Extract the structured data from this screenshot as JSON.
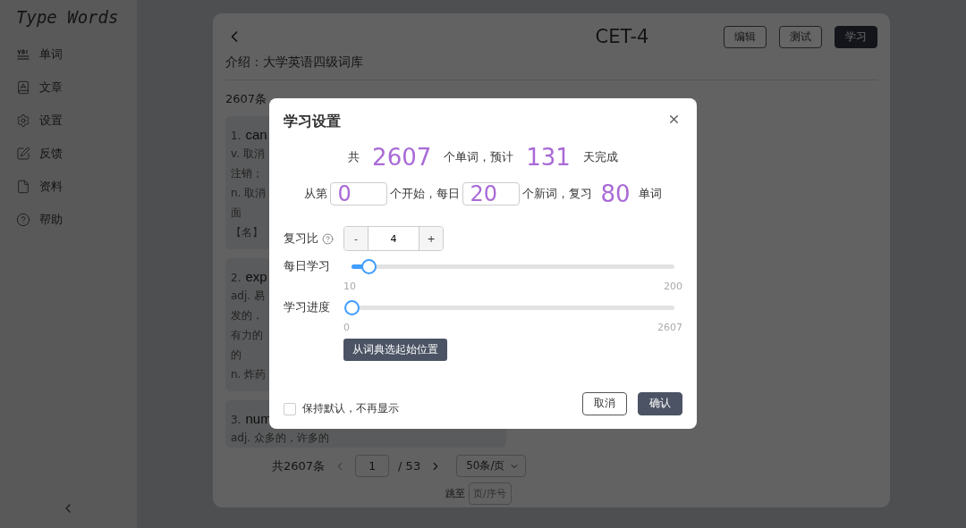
{
  "sidebar": {
    "logo": "Type Words",
    "items": [
      {
        "label": "单词"
      },
      {
        "label": "文章"
      },
      {
        "label": "设置"
      },
      {
        "label": "反馈"
      },
      {
        "label": "资料"
      },
      {
        "label": "帮助"
      }
    ]
  },
  "panel": {
    "title": "CET-4",
    "intro": "介绍：大学英语四级词库",
    "count": "2607条",
    "buttons": [
      {
        "label": "编辑",
        "kind": "outline"
      },
      {
        "label": "测试",
        "kind": "outline"
      },
      {
        "label": "学习",
        "kind": "primary"
      }
    ],
    "words": [
      {
        "index": "1.",
        "word": "can",
        "lines": [
          "v. 取消",
          "注销；",
          "n. 取消",
          "面",
          "【名】"
        ]
      },
      {
        "index": "2.",
        "word": "exp",
        "lines": [
          "adj. 易",
          "发的，",
          "有力的",
          "的",
          "n. 炸药"
        ]
      },
      {
        "index": "3.",
        "word": "num",
        "lines": [
          "adj. 众多的，许多的"
        ]
      }
    ],
    "pagination": {
      "total": "共2607条",
      "page": "1",
      "pages": "/ 53",
      "page_size": "50条/页",
      "jump_label": "跳至",
      "jump_placeholder": "页/序号"
    }
  },
  "dialog": {
    "title": "学习设置",
    "summary": [
      {
        "kind": "text",
        "text": "共"
      },
      {
        "kind": "number",
        "text": "2607"
      },
      {
        "kind": "text",
        "text": "个单词，预计"
      },
      {
        "kind": "number",
        "text": "131"
      },
      {
        "kind": "text",
        "text": "天完成"
      }
    ],
    "plan": [
      {
        "kind": "text",
        "text": "从第"
      },
      {
        "kind": "input",
        "text": "0"
      },
      {
        "kind": "text",
        "text": "个开始，每日"
      },
      {
        "kind": "input",
        "text": "20"
      },
      {
        "kind": "text",
        "text": "个新词，复习"
      },
      {
        "kind": "number",
        "text": "80"
      },
      {
        "kind": "text",
        "text": "单词"
      }
    ],
    "rows": [
      {
        "kind": "stepper",
        "label": "复习比",
        "help": true,
        "minus": "-",
        "value": "4",
        "plus": "+"
      },
      {
        "kind": "slider",
        "label": "每日学习",
        "level": 0.053,
        "min": "10",
        "max": "200"
      },
      {
        "kind": "slider",
        "label": "学习进度",
        "level": 0,
        "min": "0",
        "max": "2607",
        "action": "从词典选起始位置"
      }
    ],
    "remember": {
      "label": "保持默认，不再显示",
      "checked": false
    },
    "buttons": [
      {
        "label": "取消",
        "kind": "outline"
      },
      {
        "label": "确认",
        "kind": "primary"
      }
    ]
  }
}
